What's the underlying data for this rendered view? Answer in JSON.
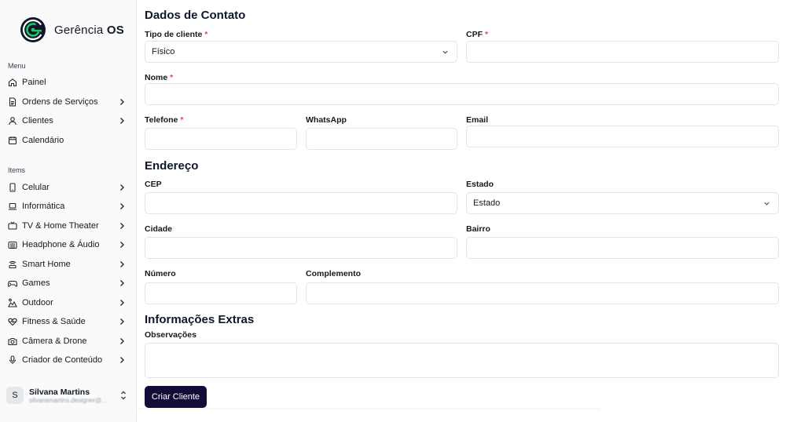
{
  "brand": {
    "name": "Gerência",
    "name_bold": "OS",
    "accent": "#16a34a"
  },
  "sidebar": {
    "menu_label": "Menu",
    "menu_items": [
      {
        "label": "Painel",
        "icon": "home-icon",
        "has_chevron": false
      },
      {
        "label": "Ordens de Serviços",
        "icon": "document-icon",
        "has_chevron": true
      },
      {
        "label": "Clientes",
        "icon": "user-icon",
        "has_chevron": true
      },
      {
        "label": "Calendário",
        "icon": "calendar-icon",
        "has_chevron": false
      }
    ],
    "items_label": "Items",
    "category_items": [
      {
        "label": "Celular",
        "icon": "smartphone-icon"
      },
      {
        "label": "Informática",
        "icon": "laptop-icon"
      },
      {
        "label": "TV & Home Theater",
        "icon": "tv-icon"
      },
      {
        "label": "Headphone & Áudio",
        "icon": "speaker-icon"
      },
      {
        "label": "Smart Home",
        "icon": "smart-home-icon"
      },
      {
        "label": "Games",
        "icon": "gamepad-icon"
      },
      {
        "label": "Outdoor",
        "icon": "outdoor-icon"
      },
      {
        "label": "Fitness & Saúde",
        "icon": "heart-pulse-icon"
      },
      {
        "label": "Câmera & Drone",
        "icon": "camera-icon"
      },
      {
        "label": "Criador de Conteúdo",
        "icon": "microphone-icon"
      }
    ],
    "user": {
      "initial": "S",
      "name": "Silvana Martins",
      "email": "silvanamartins.designer@..."
    }
  },
  "form": {
    "section_contact": "Dados de Contato",
    "tipo_cliente": {
      "label": "Tipo de cliente",
      "value": "Físico"
    },
    "cpf": {
      "label": "CPF",
      "value": ""
    },
    "nome": {
      "label": "Nome",
      "value": ""
    },
    "telefone": {
      "label": "Telefone",
      "value": ""
    },
    "whatsapp": {
      "label": "WhatsApp",
      "value": ""
    },
    "email": {
      "label": "Email",
      "value": ""
    },
    "section_address": "Endereço",
    "cep": {
      "label": "CEP",
      "value": ""
    },
    "estado": {
      "label": "Estado",
      "value": "Estado"
    },
    "cidade": {
      "label": "Cidade",
      "value": ""
    },
    "bairro": {
      "label": "Bairro",
      "value": ""
    },
    "numero": {
      "label": "Número",
      "value": ""
    },
    "complemento": {
      "label": "Complemento",
      "value": ""
    },
    "section_extras": "Informações Extras",
    "observacoes": {
      "label": "Observações",
      "value": ""
    },
    "required_mark": "*",
    "submit_label": "Criar Cliente"
  }
}
